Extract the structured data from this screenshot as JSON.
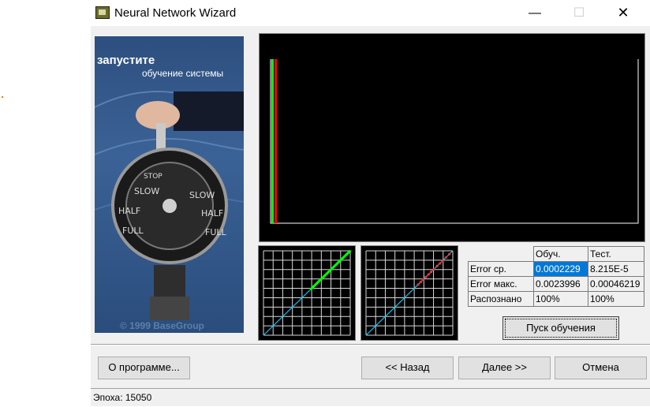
{
  "window": {
    "title": "Neural Network Wizard"
  },
  "titlebar": {
    "minimize": "—",
    "maximize": "☐",
    "close": "✕"
  },
  "banner": {
    "line1": "запустите",
    "line2": "обучение системы",
    "copyright": "© 1999 BaseGroup"
  },
  "stats": {
    "headers": [
      "",
      "Обуч.",
      "Тест."
    ],
    "rows": [
      {
        "label": "Error ср.",
        "train": "0.0002229",
        "test": "8.215E-5"
      },
      {
        "label": "Error макс.",
        "train": "0.0023996",
        "test": "0.00046219"
      },
      {
        "label": "Распознано",
        "train": "100%",
        "test": "100%"
      }
    ]
  },
  "buttons": {
    "start_training": "Пуск обучения",
    "about": "О программе...",
    "back": "<< Назад",
    "next": "Далее >>",
    "cancel": "Отмена"
  },
  "status": {
    "epoch": "Эпоха: 15050"
  },
  "colors": {
    "plot_bg": "#000000",
    "train_bar": "#00ff00",
    "test_bar": "#ff0000",
    "diagonal": "#00c8ff",
    "selection": "#0078d7"
  }
}
